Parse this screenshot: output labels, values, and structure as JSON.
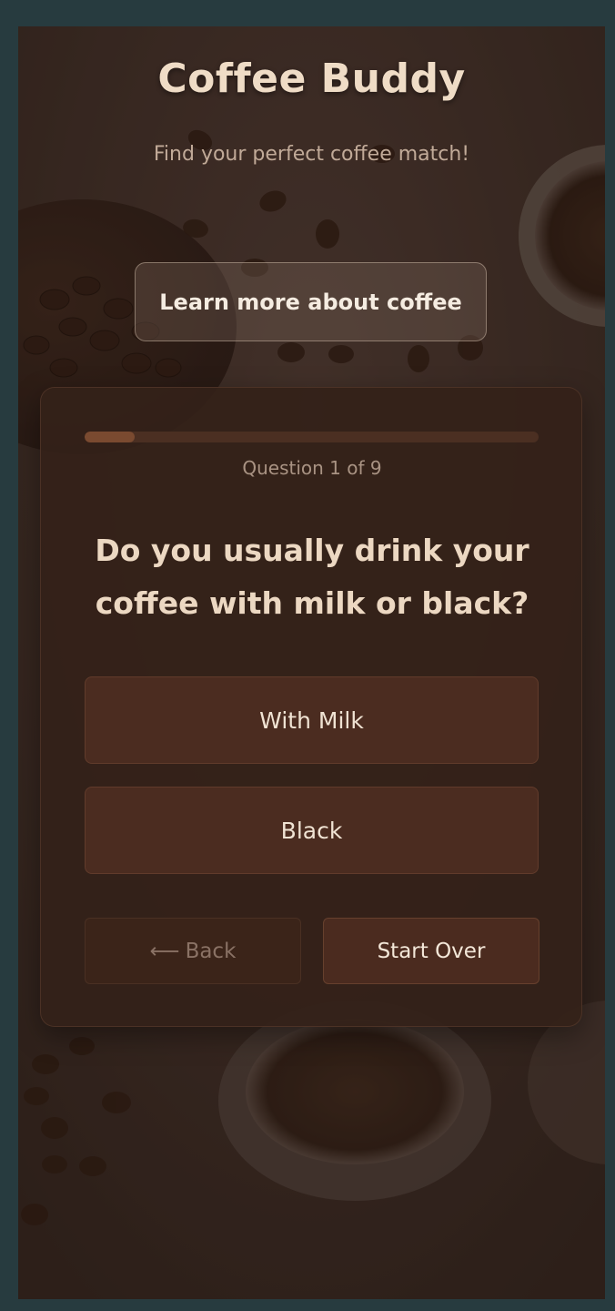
{
  "app": {
    "title": "Coffee Buddy",
    "tagline": "Find your perfect coffee match!"
  },
  "header": {
    "learn_more_label": "Learn more about coffee"
  },
  "quiz": {
    "progress_fraction": 0.11,
    "counter_text": "Question 1 of 9",
    "question": "Do you usually drink your coffee with milk or black?",
    "options": [
      {
        "label": "With Milk"
      },
      {
        "label": "Black"
      }
    ],
    "back_icon": "arrow-left-icon",
    "back_label": "Back",
    "start_over_label": "Start Over"
  },
  "colors": {
    "page_border": "#273b3f",
    "title": "#efdcc6",
    "card_bg": "#342119",
    "option_bg": "#4b2c20",
    "progress_track": "#4b2f22",
    "progress_fill": "#7a4a30"
  }
}
